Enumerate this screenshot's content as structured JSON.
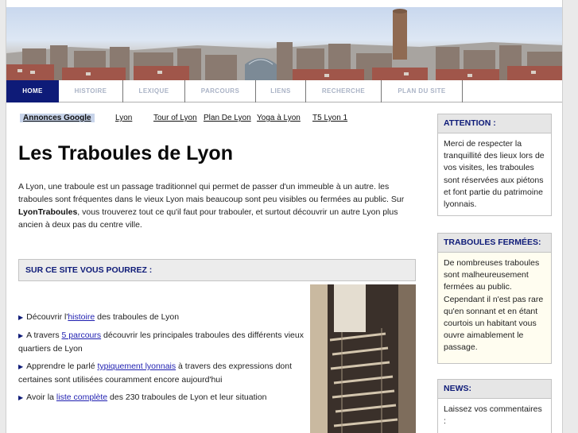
{
  "nav": {
    "items": [
      {
        "label": "HOME"
      },
      {
        "label": "HISTOIRE"
      },
      {
        "label": "LEXIQUE"
      },
      {
        "label": "PARCOURS"
      },
      {
        "label": "LIENS"
      },
      {
        "label": "RECHERCHE"
      },
      {
        "label": "PLAN DU SITE"
      }
    ]
  },
  "ads": {
    "title": "Annonces Google",
    "links": [
      "Lyon",
      "Tour of Lyon",
      "Plan De Lyon",
      "Yoga à Lyon",
      "T5 Lyon 1"
    ]
  },
  "main": {
    "title": "Les Traboules de Lyon",
    "intro_before": "A Lyon, une traboule est un passage traditionnel qui permet de passer d'un immeuble à un autre. les traboules sont fréquentes dans le vieux Lyon mais beaucoup sont peu visibles ou fermées au public. Sur ",
    "intro_bold": "LyonTraboules",
    "intro_after": ", vous trouverez tout ce qu'il faut pour trabouler, et surtout découvrir un autre Lyon plus ancien à deux pas du centre ville.",
    "section_title": "SUR CE SITE VOUS POURREZ :",
    "bullets": [
      {
        "before": "Découvrir l'",
        "link": "histoire",
        "after": " des traboules de Lyon"
      },
      {
        "before": "A travers ",
        "link": "5 parcours",
        "after": " découvrir les principales traboules des différents vieux quartiers de Lyon"
      },
      {
        "before": "Apprendre le  parlé ",
        "link": "typiquement lyonnais",
        "after": " à travers des expressions dont certaines sont utilisées couramment encore aujourd'hui"
      },
      {
        "before": "Avoir la ",
        "link": "liste complète",
        "after": " des 230 traboules de Lyon et leur situation"
      }
    ]
  },
  "sidebar": {
    "attention": {
      "title": "ATTENTION :",
      "text": "Merci de respecter la tranquillité des lieux lors de vos visites, les traboules sont réservées aux piétons et font partie du patrimoine lyonnais."
    },
    "fermees": {
      "title": "TRABOULES FERMÉES:",
      "text": "De nombreuses traboules sont malheureusement fermées au public. Cependant il n'est pas rare qu'en sonnant et en étant courtois un habitant vous ouvre aimablement le passage."
    },
    "news": {
      "title": "NEWS:",
      "text": "Laissez vos commentaires :"
    }
  },
  "colors": {
    "accent": "#0e1b78",
    "ads_bg": "#c8d4ea",
    "link": "#1f1fb0"
  }
}
